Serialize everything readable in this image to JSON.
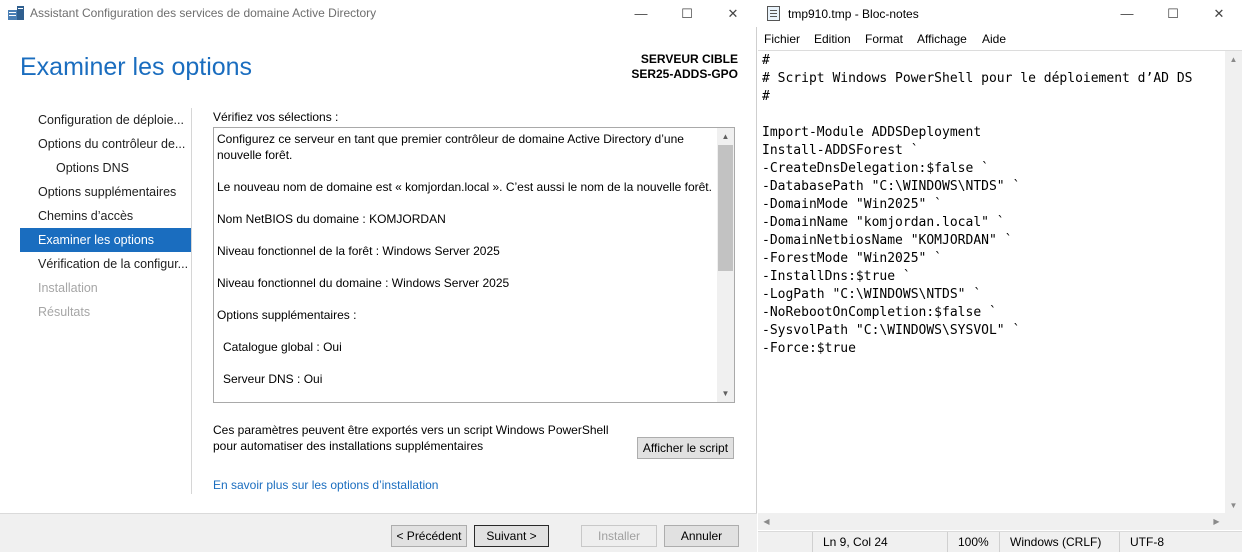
{
  "wizard": {
    "window_title": "Assistant Configuration des services de domaine Active Directory",
    "heading": "Examiner les options",
    "target_label": "SERVEUR CIBLE",
    "target_name": "SER25-ADDS-GPO",
    "nav": [
      {
        "label": "Configuration de déploie..."
      },
      {
        "label": "Options du contrôleur de..."
      },
      {
        "label": "Options DNS"
      },
      {
        "label": "Options supplémentaires"
      },
      {
        "label": "Chemins d’accès"
      },
      {
        "label": "Examiner les options"
      },
      {
        "label": "Vérification de la configur..."
      },
      {
        "label": "Installation"
      },
      {
        "label": "Résultats"
      }
    ],
    "verify_label": "Vérifiez vos sélections :",
    "summary": {
      "line1": "Configurez ce serveur en tant que premier contrôleur de domaine Active Directory d’une nouvelle forêt.",
      "line2": "Le nouveau nom de domaine est « komjordan.local ». C’est aussi le nom de la nouvelle forêt.",
      "line3": "Nom NetBIOS du domaine : KOMJORDAN",
      "line4": "Niveau fonctionnel de la forêt : Windows Server 2025",
      "line5": "Niveau fonctionnel du domaine : Windows Server 2025",
      "line6": "Options supplémentaires :",
      "line7": "Catalogue global : Oui",
      "line8": "Serveur DNS : Oui"
    },
    "export_text": "Ces paramètres peuvent être exportés vers un script Windows PowerShell pour automatiser des installations supplémentaires",
    "view_script_button": "Afficher le script",
    "learn_more_link": "En savoir plus sur les options d’installation",
    "buttons": {
      "previous": "< Précédent",
      "next": "Suivant >",
      "install": "Installer",
      "cancel": "Annuler"
    }
  },
  "notepad": {
    "window_title": "tmp910.tmp - Bloc-notes",
    "menu": [
      "Fichier",
      "Edition",
      "Format",
      "Affichage",
      "Aide"
    ],
    "content": "#\n# Script Windows PowerShell pour le déploiement d’AD DS\n#\n\nImport-Module ADDSDeployment\nInstall-ADDSForest `\n-CreateDnsDelegation:$false `\n-DatabasePath \"C:\\WINDOWS\\NTDS\" `\n-DomainMode \"Win2025\" `\n-DomainName \"komjordan.local\" `\n-DomainNetbiosName \"KOMJORDAN\" `\n-ForestMode \"Win2025\" `\n-InstallDns:$true `\n-LogPath \"C:\\WINDOWS\\NTDS\" `\n-NoRebootOnCompletion:$false `\n-SysvolPath \"C:\\WINDOWS\\SYSVOL\" `\n-Force:$true",
    "status": {
      "position": "Ln 9, Col 24",
      "zoom": "100%",
      "line_ending": "Windows (CRLF)",
      "encoding": "UTF-8"
    }
  }
}
